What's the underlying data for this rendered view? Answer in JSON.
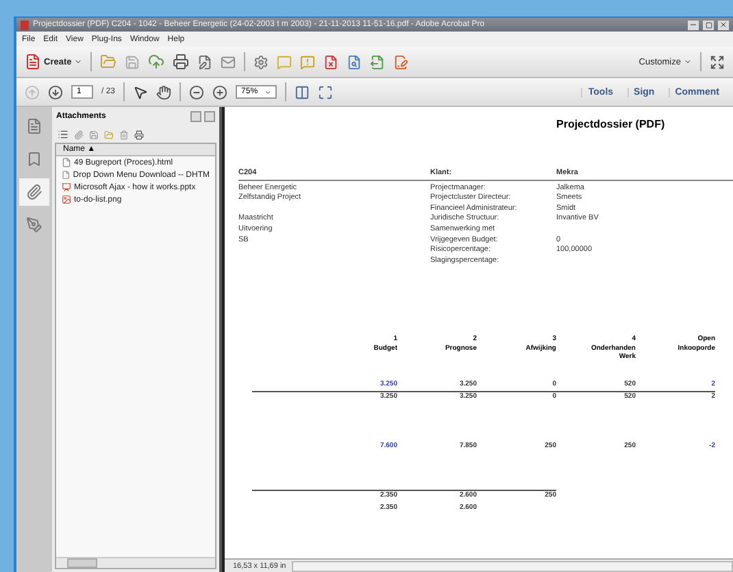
{
  "window": {
    "title": "Projectdossier (PDF) C204 - 1042 - Beheer Energetic (24-02-2003 t m 2003) - 21-11-2013 11-51-16.pdf - Adobe Acrobat Pro"
  },
  "menu": [
    "File",
    "Edit",
    "View",
    "Plug-Ins",
    "Window",
    "Help"
  ],
  "toolbar": {
    "create": "Create",
    "customize": "Customize"
  },
  "navigation": {
    "page": "1",
    "page_total": "/ 23",
    "zoom": "75%",
    "links": [
      "Tools",
      "Sign",
      "Comment"
    ]
  },
  "side_tabs": [
    {
      "kind": "pages",
      "selected": false
    },
    {
      "kind": "bookmarks",
      "selected": false
    },
    {
      "kind": "attachments",
      "selected": true
    },
    {
      "kind": "signatures",
      "selected": false
    }
  ],
  "attachments": {
    "title": "Attachments",
    "column": "Name ▲",
    "files": [
      {
        "name": "49 Bugreport (Proces).html",
        "kind": "html"
      },
      {
        "name": "Drop Down Menu Download -- DHTM",
        "kind": "html"
      },
      {
        "name": "Microsoft Ajax - how it works.pptx",
        "kind": "pptx"
      },
      {
        "name": "to-do-list.png",
        "kind": "png"
      }
    ]
  },
  "document": {
    "title": "Projectdossier (PDF)",
    "header": [
      "C204",
      "Klant:",
      "Mekra"
    ],
    "info_rows": [
      {
        "left": "Beheer Energetic",
        "label": "Projectmanager:",
        "value": "Jalkema"
      },
      {
        "left": "Zelfstandig Project",
        "label": "Projectcluster Directeur:",
        "value": "Smeets"
      },
      {
        "label": "Financieel Administrateur:",
        "value": "Smidt"
      },
      {
        "left": "Maastricht",
        "label": "Juridische Structuur:",
        "value": "Invantive BV"
      },
      {
        "left": "Uitvoering",
        "label": "Samenwerking met"
      },
      {
        "left": "SB",
        "label": "Vrijgegeven Budget:",
        "value": "0"
      },
      {
        "label": "Risicopercentage:",
        "value": "100,00000"
      },
      {
        "label": "Slagingspercentage:"
      }
    ],
    "columns": [
      {
        "number": "1",
        "label": "Budget"
      },
      {
        "number": "2",
        "label": "Prognose"
      },
      {
        "number": "3",
        "label": "Afwijking"
      },
      {
        "number": "4",
        "label": "Onderhanden Werk"
      },
      {
        "label": "Open Inkooporde"
      }
    ],
    "row_groups": [
      {
        "rows": [
          {
            "rule_above": false,
            "cells": [
              {
                "text": "3.250",
                "link": true
              },
              {
                "text": "3.250",
                "link": false
              },
              {
                "text": "0",
                "link": false
              },
              {
                "text": "520",
                "link": false
              },
              {
                "text": "2",
                "link": true
              }
            ]
          },
          {
            "rule_above": true,
            "cells": [
              {
                "text": "3.250",
                "link": false
              },
              {
                "text": "3.250",
                "link": false
              },
              {
                "text": "0",
                "link": false
              },
              {
                "text": "520",
                "link": false
              },
              {
                "text": "2",
                "link": false
              }
            ]
          }
        ]
      },
      {
        "rows": [
          {
            "rule_above": false,
            "cells": [
              {
                "text": "7.600",
                "link": true
              },
              {
                "text": "7.850",
                "link": false
              },
              {
                "text": "250",
                "link": false
              },
              {
                "text": "250",
                "link": false
              },
              {
                "text": "-2",
                "link": true
              }
            ]
          }
        ]
      },
      {
        "rows": [
          {
            "rule_above": true,
            "cells": [
              {
                "text": "2.350",
                "link": false
              },
              {
                "text": "2.600",
                "link": false
              },
              {
                "text": "250",
                "link": false
              }
            ]
          },
          {
            "rule_above": false,
            "cells": [
              {
                "text": "2.350",
                "link": false
              },
              {
                "text": "2.600",
                "link": false
              }
            ]
          }
        ]
      }
    ]
  },
  "status_bar": {
    "page_size": "16,53 x 11,69 in"
  }
}
